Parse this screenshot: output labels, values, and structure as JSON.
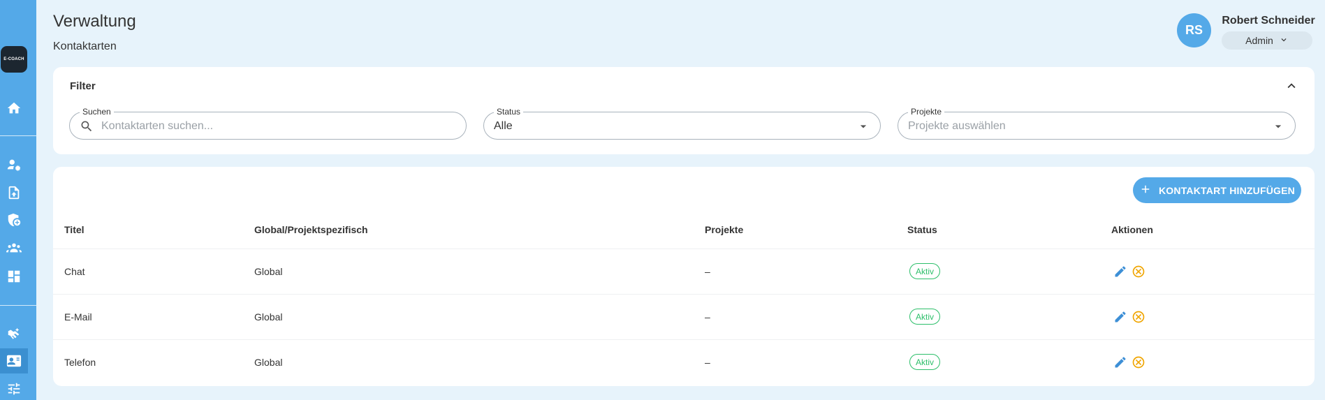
{
  "app": {
    "logo_text": "E-COACH"
  },
  "sidebar": {
    "items": [
      {
        "icon": "home-icon"
      },
      {
        "icon": "user-settings-icon"
      },
      {
        "icon": "file-upload-icon"
      },
      {
        "icon": "shield-add-icon"
      },
      {
        "icon": "groups-icon"
      },
      {
        "icon": "dashboard-icon"
      },
      {
        "icon": "contact-handshake-icon"
      },
      {
        "icon": "contact-card-icon",
        "active": true
      },
      {
        "icon": "tune-icon"
      }
    ]
  },
  "header": {
    "title": "Verwaltung",
    "subtitle": "Kontaktarten",
    "user": {
      "initials": "RS",
      "name": "Robert Schneider",
      "role": "Admin"
    }
  },
  "filter": {
    "title": "Filter",
    "search": {
      "label": "Suchen",
      "placeholder": "Kontaktarten suchen..."
    },
    "status": {
      "label": "Status",
      "value": "Alle"
    },
    "projects": {
      "label": "Projekte",
      "placeholder": "Projekte auswählen"
    }
  },
  "table": {
    "add_button_label": "KONTAKTART HINZUFÜGEN",
    "columns": [
      "Titel",
      "Global/Projektspezifisch",
      "Projekte",
      "Status",
      "Aktionen"
    ],
    "rows": [
      {
        "title": "Chat",
        "scope": "Global",
        "projects": "–",
        "status": "Aktiv"
      },
      {
        "title": "E-Mail",
        "scope": "Global",
        "projects": "–",
        "status": "Aktiv"
      },
      {
        "title": "Telefon",
        "scope": "Global",
        "projects": "–",
        "status": "Aktiv"
      }
    ]
  },
  "colors": {
    "primary": "#54a9e8",
    "background": "#e7f3fb",
    "status_active": "#2dbf6a",
    "edit": "#3d8fd6",
    "deactivate": "#f0a500"
  }
}
